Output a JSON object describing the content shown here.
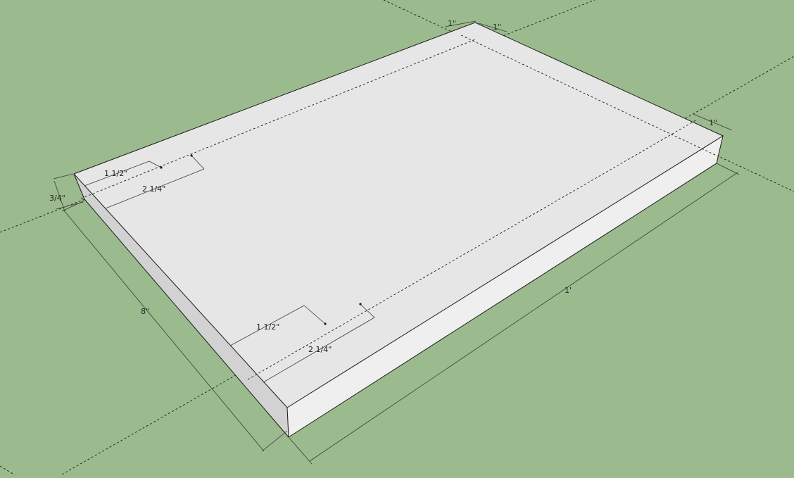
{
  "scene": {
    "background_color": "#9bbb8e",
    "top_face_color": "#e6e6e6",
    "front_face_color": "#efefef",
    "left_face_color": "#d2d2d2"
  },
  "dimensions": {
    "thickness": "3/4\"",
    "width": "8\"",
    "length": "1'",
    "offset_back_left": "1\"",
    "offset_back_right": "1\"",
    "offset_right_edge": "1\"",
    "hole_near_a": "1 1/2\"",
    "hole_far_a": "2 1/4\"",
    "hole_near_b": "1 1/2\"",
    "hole_far_b": "2 1/4\""
  }
}
